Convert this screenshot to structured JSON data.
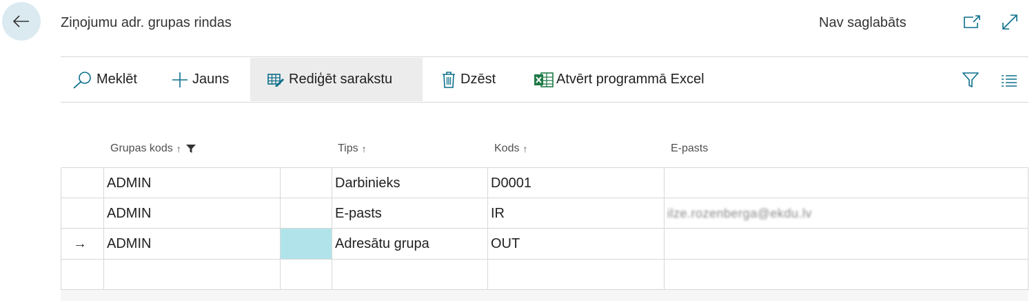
{
  "header": {
    "title": "Ziņojumu adr. grupas rindas",
    "status": "Nav saglabāts"
  },
  "actions": {
    "search": "Meklēt",
    "new": "Jauns",
    "edit_list": "Rediģēt sarakstu",
    "delete": "Dzēst",
    "open_excel": "Atvērt programmā Excel"
  },
  "columns": {
    "group_code": "Grupas kods",
    "type": "Tips",
    "code": "Kods",
    "email": "E-pasts",
    "sort_arrow": "↑"
  },
  "rows": [
    {
      "group_code": "ADMIN",
      "type": "Darbinieks",
      "code": "D0001",
      "email": ""
    },
    {
      "group_code": "ADMIN",
      "type": "E-pasts",
      "code": "IR",
      "email": "ilze.rozenberga@ekdu.lv"
    },
    {
      "group_code": "ADMIN",
      "type": "Adresātu grupa",
      "code": "OUT",
      "email": "",
      "current": true
    }
  ],
  "row_marker": "→",
  "colors": {
    "back_button_bg": "#dbeaf1",
    "accent": "#0a6e8a",
    "selected_cell": "#b1e4ea",
    "excel_green": "#1f7a46"
  }
}
